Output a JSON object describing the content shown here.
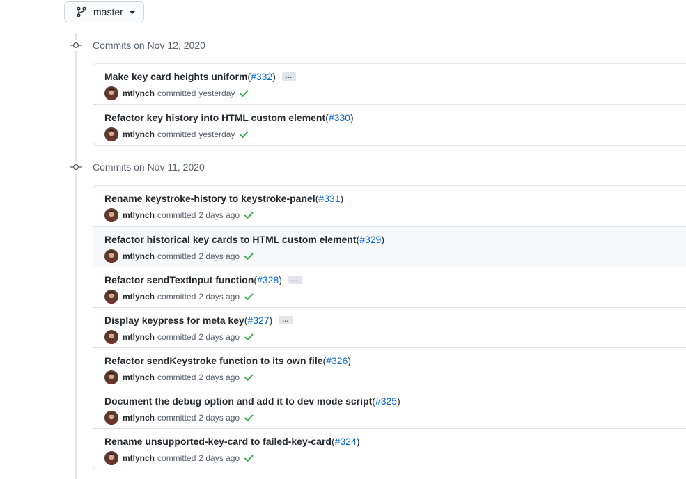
{
  "branch": {
    "name": "master",
    "icon": "git-branch-icon"
  },
  "colors": {
    "link": "#0366d6",
    "success": "#28a745",
    "muted": "#586069",
    "border": "#e1e4e8"
  },
  "groups": [
    {
      "heading": "Commits on Nov 12, 2020",
      "commits": [
        {
          "message": "Make key card heights uniform",
          "open_paren": "(",
          "pr": "#332",
          "close_paren": ")",
          "author": "mtlynch",
          "verb": "committed",
          "when": "yesterday",
          "has_ellipsis": true,
          "ellipsis": "…"
        },
        {
          "message": "Refactor key history into HTML custom element",
          "open_paren": "(",
          "pr": "#330",
          "close_paren": ")",
          "author": "mtlynch",
          "verb": "committed",
          "when": "yesterday",
          "has_ellipsis": false,
          "ellipsis": ""
        }
      ]
    },
    {
      "heading": "Commits on Nov 11, 2020",
      "commits": [
        {
          "message": "Rename keystroke-history to keystroke-panel",
          "open_paren": "(",
          "pr": "#331",
          "close_paren": ")",
          "author": "mtlynch",
          "verb": "committed",
          "when": "2 days ago",
          "has_ellipsis": false,
          "ellipsis": ""
        },
        {
          "message": "Refactor historical key cards to HTML custom element",
          "open_paren": "(",
          "pr": "#329",
          "close_paren": ")",
          "author": "mtlynch",
          "verb": "committed",
          "when": "2 days ago",
          "has_ellipsis": false,
          "ellipsis": "",
          "hovered": true
        },
        {
          "message": "Refactor sendTextInput function",
          "open_paren": "(",
          "pr": "#328",
          "close_paren": ")",
          "author": "mtlynch",
          "verb": "committed",
          "when": "2 days ago",
          "has_ellipsis": true,
          "ellipsis": "…"
        },
        {
          "message": "Display keypress for meta key",
          "open_paren": "(",
          "pr": "#327",
          "close_paren": ")",
          "author": "mtlynch",
          "verb": "committed",
          "when": "2 days ago",
          "has_ellipsis": true,
          "ellipsis": "…"
        },
        {
          "message": "Refactor sendKeystroke function to its own file",
          "open_paren": "(",
          "pr": "#326",
          "close_paren": ")",
          "author": "mtlynch",
          "verb": "committed",
          "when": "2 days ago",
          "has_ellipsis": false,
          "ellipsis": ""
        },
        {
          "message": "Document the debug option and add it to dev mode script",
          "open_paren": "(",
          "pr": "#325",
          "close_paren": ")",
          "author": "mtlynch",
          "verb": "committed",
          "when": "2 days ago",
          "has_ellipsis": false,
          "ellipsis": ""
        },
        {
          "message": "Rename unsupported-key-card to failed-key-card",
          "open_paren": "(",
          "pr": "#324",
          "close_paren": ")",
          "author": "mtlynch",
          "verb": "committed",
          "when": "2 days ago",
          "has_ellipsis": false,
          "ellipsis": ""
        }
      ]
    }
  ]
}
